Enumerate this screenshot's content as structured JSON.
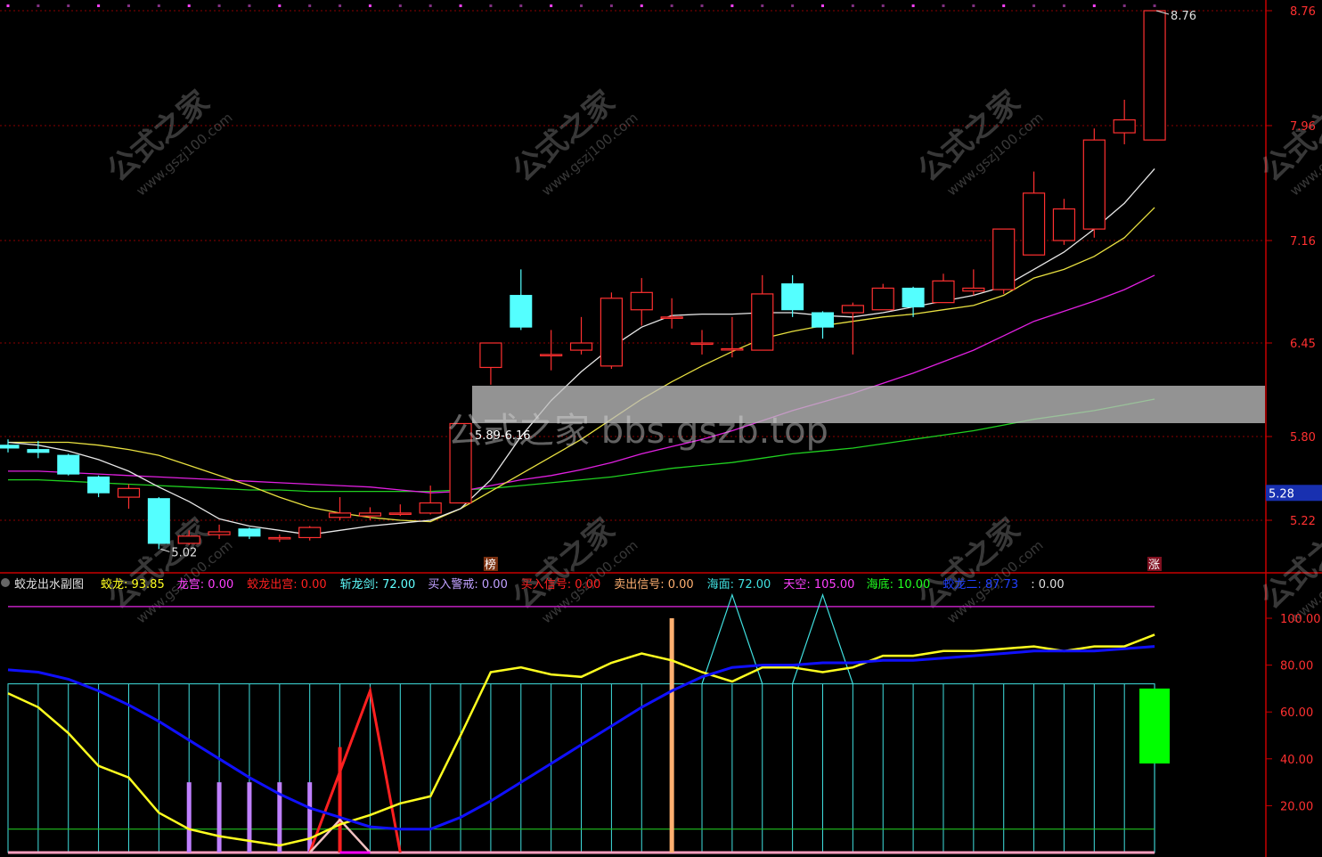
{
  "colors": {
    "bg": "#000000",
    "axis": "#c80000",
    "grid": "#8b0000",
    "up": "#ff3030",
    "down": "#54ffff",
    "ma_white": "#e8e8e8",
    "ma_yellow": "#e8e040",
    "ma_magenta": "#e020e0",
    "ma_green": "#20d020",
    "ind_yellow": "#ffff20",
    "ind_blue": "#1010ff",
    "ind_cyan": "#40e0e0",
    "ind_purple": "#c080ff",
    "ind_red": "#ff2020",
    "ind_orange": "#ffb070",
    "ind_green": "#00ff00",
    "ind_magenta": "#c020c0",
    "ind_pink": "#ffa0c0"
  },
  "watermark": {
    "text": "公式之家 bbs.gszb.top",
    "logo_cn": "公式之家",
    "logo_url": "www.gszj100.com"
  },
  "main": {
    "price_ticks": [
      "8.76",
      "7.96",
      "7.16",
      "6.45",
      "5.80",
      "5.22"
    ],
    "current_price": "5.28",
    "high_label": "8.76",
    "low_label": "5.02",
    "box_label": "5.89-6.16",
    "marker_bang": "榜",
    "marker_zhang": "涨"
  },
  "sub": {
    "title": "蛟龙出水副图",
    "legend": [
      {
        "name": "蛟龙",
        "value": "93.85",
        "color": "#ffff20"
      },
      {
        "name": "龙宫",
        "value": "0.00",
        "color": "#ff40ff"
      },
      {
        "name": "蛟龙出宫",
        "value": "0.00",
        "color": "#ff2020"
      },
      {
        "name": "斩龙剑",
        "value": "72.00",
        "color": "#60ffff"
      },
      {
        "name": "买入警戒",
        "value": "0.00",
        "color": "#c0a0ff"
      },
      {
        "name": "买入信号",
        "value": "0.00",
        "color": "#ff2020"
      },
      {
        "name": "卖出信号",
        "value": "0.00",
        "color": "#ffb070"
      },
      {
        "name": "海面",
        "value": "72.00",
        "color": "#40e0e0"
      },
      {
        "name": "天空",
        "value": "105.00",
        "color": "#ff40ff"
      },
      {
        "name": "海底",
        "value": "10.00",
        "color": "#20ff20"
      },
      {
        "name": "蛟龙二",
        "value": "87.73",
        "color": "#2040ff"
      },
      {
        "name": "",
        "value": "0.00",
        "color": "#e0e0e0"
      }
    ],
    "ticks": [
      "100.00",
      "80.00",
      "60.00",
      "40.00",
      "20.00"
    ]
  },
  "chart_data": {
    "type": "candlestick",
    "panels": [
      {
        "name": "main",
        "ylim": [
          5.0,
          8.8
        ],
        "candles": [
          {
            "o": 5.74,
            "c": 5.72,
            "h": 5.78,
            "l": 5.69
          },
          {
            "o": 5.71,
            "c": 5.69,
            "h": 5.77,
            "l": 5.65
          },
          {
            "o": 5.67,
            "c": 5.54,
            "h": 5.68,
            "l": 5.53
          },
          {
            "o": 5.52,
            "c": 5.41,
            "h": 5.53,
            "l": 5.38
          },
          {
            "o": 5.38,
            "c": 5.44,
            "h": 5.47,
            "l": 5.3
          },
          {
            "o": 5.37,
            "c": 5.06,
            "h": 5.38,
            "l": 5.02
          },
          {
            "o": 5.06,
            "c": 5.11,
            "h": 5.15,
            "l": 5.05
          },
          {
            "o": 5.12,
            "c": 5.14,
            "h": 5.19,
            "l": 5.09
          },
          {
            "o": 5.16,
            "c": 5.11,
            "h": 5.17,
            "l": 5.09
          },
          {
            "o": 5.1,
            "c": 5.1,
            "h": 5.12,
            "l": 5.07
          },
          {
            "o": 5.1,
            "c": 5.17,
            "h": 5.18,
            "l": 5.08
          },
          {
            "o": 5.24,
            "c": 5.27,
            "h": 5.38,
            "l": 5.22
          },
          {
            "o": 5.25,
            "c": 5.27,
            "h": 5.31,
            "l": 5.22
          },
          {
            "o": 5.27,
            "c": 5.27,
            "h": 5.33,
            "l": 5.25
          },
          {
            "o": 5.27,
            "c": 5.34,
            "h": 5.46,
            "l": 5.26
          },
          {
            "o": 5.34,
            "c": 5.89,
            "h": 5.89,
            "l": 5.34
          },
          {
            "o": 6.28,
            "c": 6.45,
            "h": 6.45,
            "l": 6.16
          },
          {
            "o": 6.78,
            "c": 6.56,
            "h": 6.96,
            "l": 6.54
          },
          {
            "o": 6.37,
            "c": 6.37,
            "h": 6.54,
            "l": 6.26
          },
          {
            "o": 6.4,
            "c": 6.45,
            "h": 6.63,
            "l": 6.37
          },
          {
            "o": 6.29,
            "c": 6.76,
            "h": 6.8,
            "l": 6.27
          },
          {
            "o": 6.68,
            "c": 6.8,
            "h": 6.9,
            "l": 6.57
          },
          {
            "o": 6.63,
            "c": 6.63,
            "h": 6.76,
            "l": 6.55
          },
          {
            "o": 6.45,
            "c": 6.45,
            "h": 6.54,
            "l": 6.37
          },
          {
            "o": 6.41,
            "c": 6.41,
            "h": 6.63,
            "l": 6.35
          },
          {
            "o": 6.4,
            "c": 6.79,
            "h": 6.92,
            "l": 6.4
          },
          {
            "o": 6.86,
            "c": 6.68,
            "h": 6.92,
            "l": 6.63
          },
          {
            "o": 6.66,
            "c": 6.56,
            "h": 6.67,
            "l": 6.48
          },
          {
            "o": 6.66,
            "c": 6.71,
            "h": 6.73,
            "l": 6.37
          },
          {
            "o": 6.68,
            "c": 6.83,
            "h": 6.86,
            "l": 6.68
          },
          {
            "o": 6.83,
            "c": 6.7,
            "h": 6.84,
            "l": 6.63
          },
          {
            "o": 6.73,
            "c": 6.88,
            "h": 6.93,
            "l": 6.73
          },
          {
            "o": 6.81,
            "c": 6.83,
            "h": 6.96,
            "l": 6.78
          },
          {
            "o": 6.82,
            "c": 7.24,
            "h": 7.24,
            "l": 6.79
          },
          {
            "o": 7.06,
            "c": 7.49,
            "h": 7.64,
            "l": 7.06
          },
          {
            "o": 7.16,
            "c": 7.38,
            "h": 7.45,
            "l": 7.13
          },
          {
            "o": 7.24,
            "c": 7.86,
            "h": 7.94,
            "l": 7.18
          },
          {
            "o": 7.91,
            "c": 8.0,
            "h": 8.14,
            "l": 7.83
          },
          {
            "o": 7.86,
            "c": 8.76,
            "h": 8.76,
            "l": 7.86
          }
        ],
        "ma_white": [
          5.76,
          5.74,
          5.7,
          5.64,
          5.56,
          5.45,
          5.35,
          5.23,
          5.18,
          5.15,
          5.12,
          5.15,
          5.18,
          5.2,
          5.22,
          5.3,
          5.5,
          5.8,
          6.05,
          6.25,
          6.42,
          6.56,
          6.64,
          6.65,
          6.65,
          6.66,
          6.66,
          6.64,
          6.63,
          6.66,
          6.7,
          6.74,
          6.78,
          6.84,
          6.96,
          7.08,
          7.24,
          7.42,
          7.66
        ],
        "ma_yellow": [
          5.76,
          5.76,
          5.76,
          5.74,
          5.71,
          5.67,
          5.6,
          5.53,
          5.46,
          5.38,
          5.31,
          5.27,
          5.24,
          5.22,
          5.21,
          5.3,
          5.42,
          5.54,
          5.66,
          5.78,
          5.92,
          6.06,
          6.18,
          6.29,
          6.39,
          6.48,
          6.53,
          6.57,
          6.6,
          6.63,
          6.65,
          6.68,
          6.71,
          6.78,
          6.9,
          6.96,
          7.05,
          7.18,
          7.39
        ],
        "ma_magenta": [
          5.56,
          5.56,
          5.55,
          5.54,
          5.53,
          5.52,
          5.51,
          5.5,
          5.49,
          5.48,
          5.47,
          5.46,
          5.45,
          5.43,
          5.41,
          5.42,
          5.46,
          5.5,
          5.53,
          5.57,
          5.62,
          5.68,
          5.73,
          5.78,
          5.84,
          5.91,
          5.98,
          6.04,
          6.1,
          6.17,
          6.24,
          6.32,
          6.4,
          6.5,
          6.6,
          6.67,
          6.74,
          6.82,
          6.92
        ],
        "ma_green": [
          5.5,
          5.5,
          5.49,
          5.48,
          5.47,
          5.46,
          5.45,
          5.44,
          5.43,
          5.43,
          5.42,
          5.42,
          5.42,
          5.42,
          5.42,
          5.43,
          5.44,
          5.46,
          5.48,
          5.5,
          5.52,
          5.55,
          5.58,
          5.6,
          5.62,
          5.65,
          5.68,
          5.7,
          5.72,
          5.75,
          5.78,
          5.81,
          5.84,
          5.88,
          5.92,
          5.95,
          5.98,
          6.02,
          6.06
        ]
      },
      {
        "name": "sub",
        "ylim": [
          0,
          120
        ],
        "jiaolong": [
          68,
          62,
          51,
          37,
          32,
          17,
          10,
          7,
          5,
          3,
          6,
          12,
          16,
          21,
          24,
          50,
          77,
          79,
          76,
          75,
          81,
          85,
          82,
          77,
          73,
          79,
          79,
          77,
          79,
          84,
          84,
          86,
          86,
          87,
          88,
          86,
          88,
          88,
          93
        ],
        "jiaolong2": [
          78,
          77,
          74,
          69,
          63,
          56,
          48,
          40,
          32,
          25,
          19,
          15,
          11,
          10,
          10,
          15,
          22,
          30,
          38,
          46,
          54,
          62,
          69,
          75,
          79,
          80,
          80,
          81,
          81,
          82,
          82,
          83,
          84,
          85,
          86,
          86,
          86,
          87,
          88
        ],
        "haimian": 72,
        "tiankong": 105,
        "haidi": 10,
        "buy_alert_bars": [
          6,
          7,
          8,
          9,
          10
        ],
        "buy_alert_value": 30,
        "buy_signal_bars": [
          11
        ],
        "buy_signal_value": 45,
        "sell_signal_bars": [
          22
        ],
        "sell_signal_value": 100,
        "spike_red": {
          "from": 11,
          "peak": 12,
          "to": 13,
          "value": 69
        },
        "spike_cyan": [
          {
            "from": 23,
            "peak": 24,
            "to": 25,
            "value": 110
          },
          {
            "from": 26,
            "peak": 27,
            "to": 28,
            "value": 110
          }
        ],
        "green_block": {
          "bar": 38,
          "from": 38,
          "to": 70
        }
      }
    ]
  }
}
